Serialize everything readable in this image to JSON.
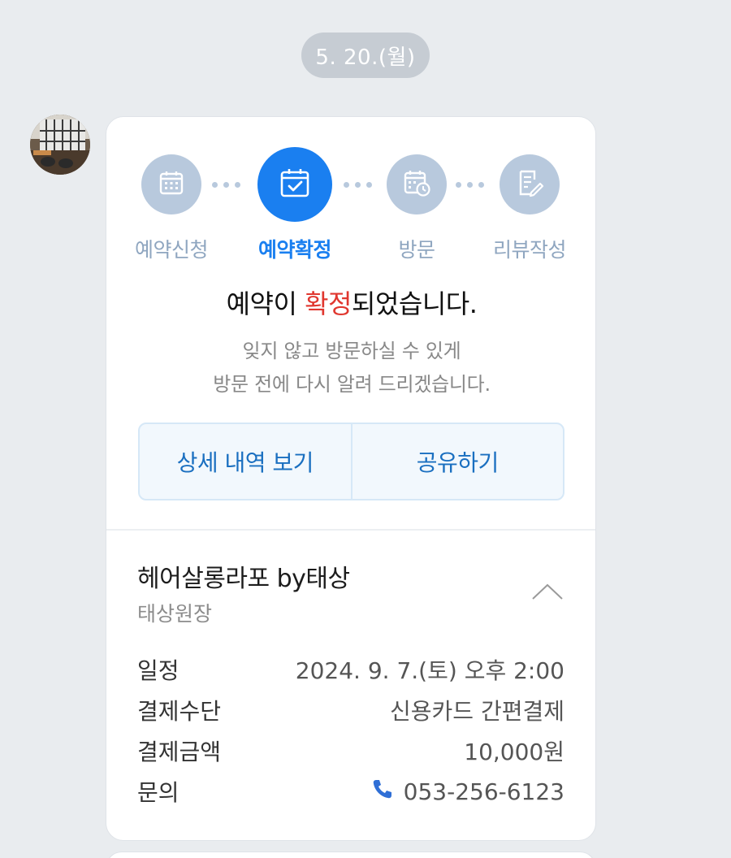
{
  "date_divider": "5. 20.(월)",
  "avatar": {
    "label": "salon-profile-photo"
  },
  "steps": [
    {
      "label": "예약신청",
      "icon": "calendar-grid-icon",
      "state": "done"
    },
    {
      "label": "예약확정",
      "icon": "calendar-check-icon",
      "state": "active"
    },
    {
      "label": "방문",
      "icon": "calendar-clock-icon",
      "state": "done"
    },
    {
      "label": "리뷰작성",
      "icon": "document-pencil-icon",
      "state": "done"
    }
  ],
  "headline": {
    "before": "예약이 ",
    "highlight": "확정",
    "after": "되었습니다."
  },
  "subtext": [
    "잊지 않고 방문하실 수 있게",
    "방문 전에 다시 알려 드리겠습니다."
  ],
  "buttons": {
    "details": "상세 내역 보기",
    "share": "공유하기"
  },
  "shop": {
    "name": "헤어살롱라포 by태상",
    "designer": "태상원장"
  },
  "info": [
    {
      "label": "일정",
      "value": "2024. 9. 7.(토) 오후 2:00"
    },
    {
      "label": "결제수단",
      "value": "신용카드 간편결제"
    },
    {
      "label": "결제금액",
      "value": "10,000원"
    },
    {
      "label": "문의",
      "value": "053-256-6123",
      "icon": "phone-icon"
    }
  ],
  "colors": {
    "accent": "#1a7ff0",
    "highlight": "#e0372f",
    "step_inactive": "#b8c9dd",
    "background": "#e9ecef"
  }
}
